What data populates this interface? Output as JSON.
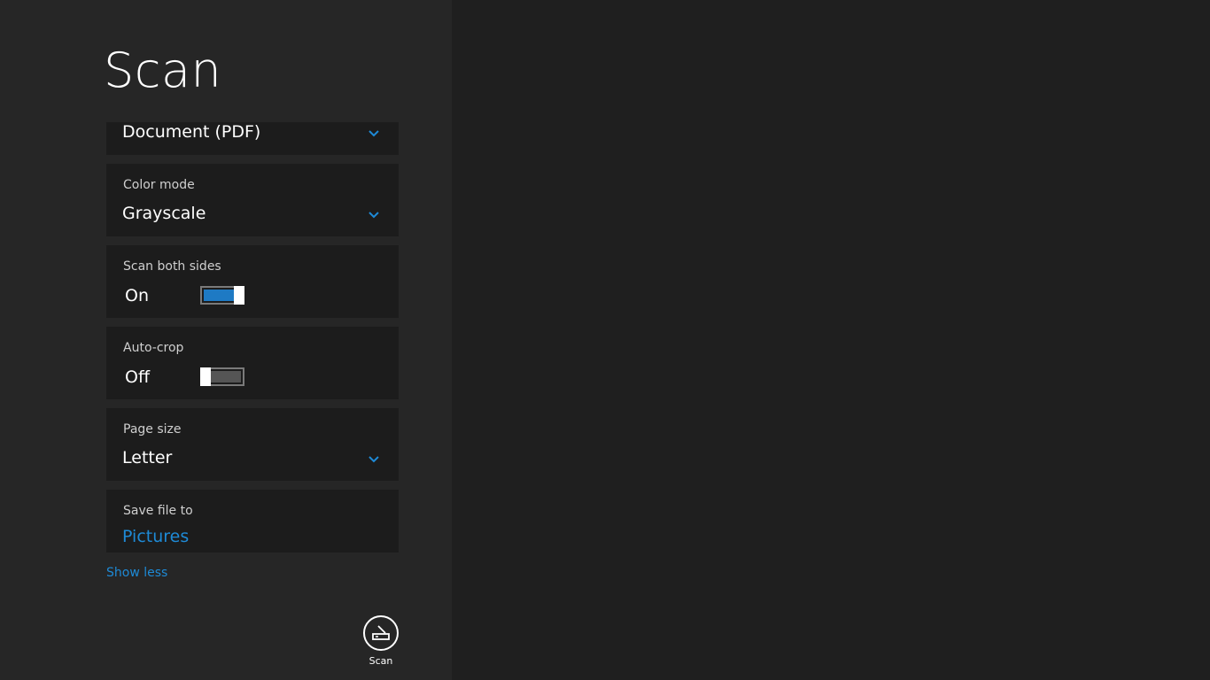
{
  "page": {
    "title": "Scan"
  },
  "settings": {
    "file_type": {
      "value": "Document (PDF)"
    },
    "color_mode": {
      "label": "Color mode",
      "value": "Grayscale"
    },
    "scan_both_sides": {
      "label": "Scan both sides",
      "state": "On",
      "on": true
    },
    "auto_crop": {
      "label": "Auto-crop",
      "state": "Off",
      "on": false
    },
    "page_size": {
      "label": "Page size",
      "value": "Letter"
    },
    "save_file_to": {
      "label": "Save file to",
      "value": "Pictures"
    }
  },
  "show_less": "Show less",
  "appbar": {
    "scan_label": "Scan",
    "icon": "scanner-icon"
  },
  "colors": {
    "accent": "#1e7ac4",
    "link": "#1e8ad6",
    "pane": "#262626",
    "card": "#1c1c1c",
    "background": "#1f1f1f"
  }
}
